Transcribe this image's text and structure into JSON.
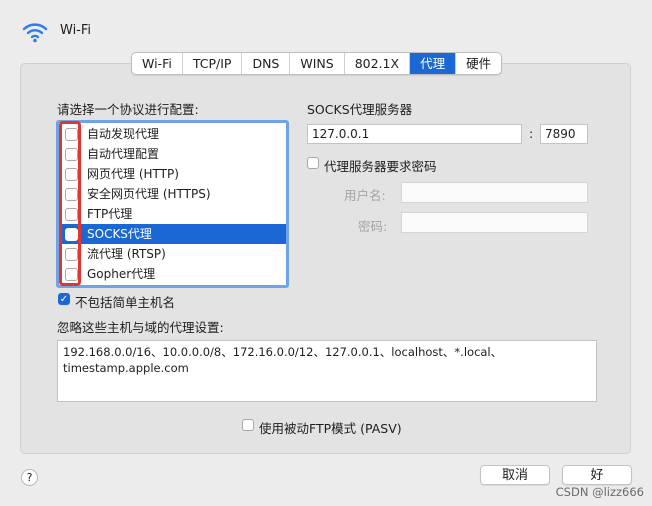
{
  "header": {
    "title": "Wi-Fi",
    "icon": "wifi-icon"
  },
  "tabs": [
    "Wi-Fi",
    "TCP/IP",
    "DNS",
    "WINS",
    "802.1X",
    "代理",
    "硬件"
  ],
  "protocols": {
    "heading": "请选择一个协议进行配置:",
    "items": [
      {
        "label": "自动发现代理",
        "checked": false,
        "selected": false
      },
      {
        "label": "自动代理配置",
        "checked": false,
        "selected": false
      },
      {
        "label": "网页代理 (HTTP)",
        "checked": false,
        "selected": false
      },
      {
        "label": "安全网页代理 (HTTPS)",
        "checked": false,
        "selected": false
      },
      {
        "label": "FTP代理",
        "checked": false,
        "selected": false
      },
      {
        "label": "SOCKS代理",
        "checked": false,
        "selected": true
      },
      {
        "label": "流代理 (RTSP)",
        "checked": false,
        "selected": false
      },
      {
        "label": "Gopher代理",
        "checked": false,
        "selected": false
      }
    ]
  },
  "socks": {
    "heading": "SOCKS代理服务器",
    "host": "127.0.0.1",
    "separator": ":",
    "port": "7890",
    "require_password_label": "代理服务器要求密码",
    "username_label": "用户名:",
    "password_label": "密码:"
  },
  "exclude_simple": {
    "label": "不包括简单主机名",
    "checked": true
  },
  "bypass": {
    "heading": "忽略这些主机与域的代理设置:",
    "value": "192.168.0.0/16、10.0.0.0/8、172.16.0.0/12、127.0.0.1、localhost、*.local、timestamp.apple.com"
  },
  "pasv": {
    "label": "使用被动FTP模式 (PASV)",
    "checked": false
  },
  "buttons": {
    "help": "?",
    "cancel": "取消",
    "ok": "好"
  },
  "watermark": "CSDN @lizz666",
  "colors": {
    "accent": "#1b67d3",
    "highlight_box": "#e3352b"
  }
}
